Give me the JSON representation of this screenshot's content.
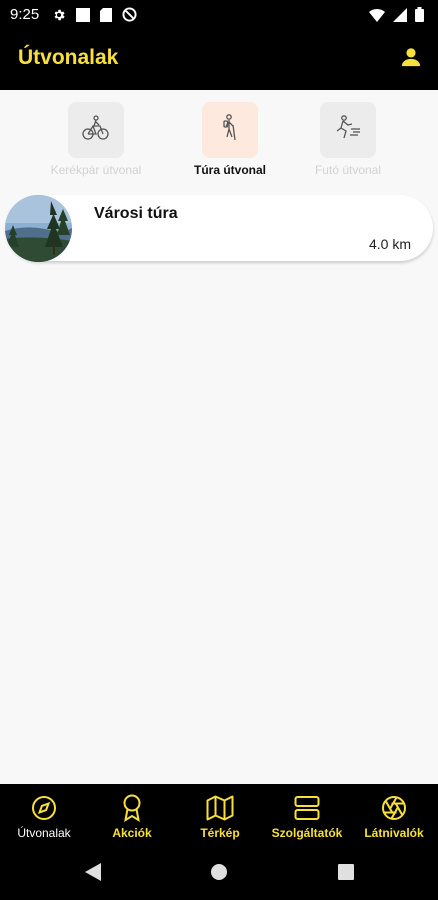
{
  "status_bar": {
    "time": "9:25",
    "left_icons": [
      "gear-icon",
      "square-icon",
      "sd-card-icon",
      "no-disturb-icon"
    ],
    "right_icons": [
      "wifi-icon",
      "signal-icon",
      "battery-icon"
    ]
  },
  "app_bar": {
    "title": "Útvonalak",
    "account_icon": "person-icon"
  },
  "categories": [
    {
      "label": "Kerékpár útvonal",
      "icon": "bicycle-icon",
      "active": false
    },
    {
      "label": "Túra útvonal",
      "icon": "hiker-icon",
      "active": true
    },
    {
      "label": "Futó útvonal",
      "icon": "runner-icon",
      "active": false
    }
  ],
  "routes": [
    {
      "name": "Városi túra",
      "distance": "4.0 km"
    }
  ],
  "bottom_nav": [
    {
      "label": "Útvonalak",
      "icon": "compass-icon",
      "active": true
    },
    {
      "label": "Akciók",
      "icon": "award-icon",
      "active": false
    },
    {
      "label": "Térkép",
      "icon": "map-icon",
      "active": false
    },
    {
      "label": "Szolgáltatók",
      "icon": "server-icon",
      "active": false
    },
    {
      "label": "Látnivalók",
      "icon": "aperture-icon",
      "active": false
    }
  ],
  "colors": {
    "accent": "#f7e03a",
    "app_bar_bg": "#000000",
    "content_bg": "#f8f8f8",
    "active_category_bg": "#fde9dd"
  }
}
